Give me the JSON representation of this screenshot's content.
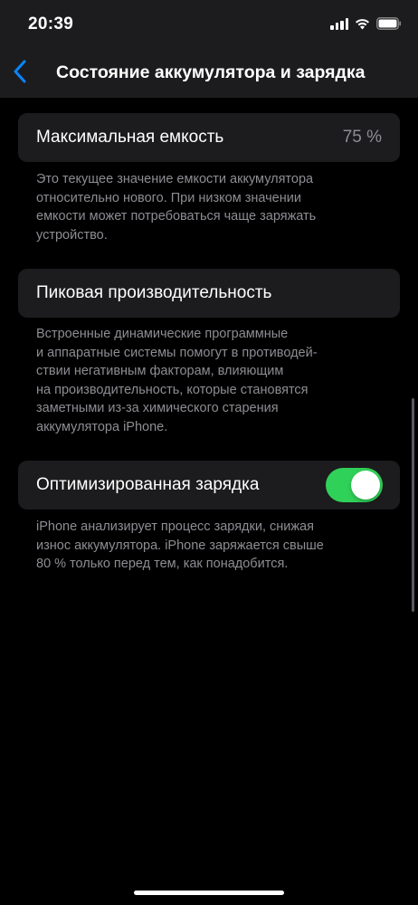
{
  "status_bar": {
    "time": "20:39",
    "icons": [
      "signal-icon",
      "wifi-icon",
      "battery-icon"
    ]
  },
  "nav": {
    "back_icon": "chevron-left-icon",
    "title": "Состояние аккумулятора и зарядка"
  },
  "max_capacity": {
    "label": "Максимальная емкость",
    "value": "75 %",
    "footnote": "Это текущее значение емкости аккумулятора\nотносительно нового. При низком значении\nемкости может потребоваться чаще заряжать\nустройство."
  },
  "peak_performance": {
    "label": "Пиковая производительность",
    "footnote": "Встроенные динамические программные\nи аппаратные системы помогут в противодей-\nствии негативным факторам, влияющим\nна производительность, которые становятся\nзаметными из-за химического старения\nаккумулятора iPhone."
  },
  "optimized_charging": {
    "label": "Оптимизированная зарядка",
    "enabled": true,
    "footnote": "iPhone анализирует процесс зарядки, снижая\nизнос аккумулятора. iPhone заряжается свыше\n80 % только перед тем, как понадобится."
  },
  "colors": {
    "accent": "#0a84ff",
    "toggle_on": "#30d158",
    "cell_background": "#1c1c1e",
    "secondary_text": "#8d8d93"
  }
}
